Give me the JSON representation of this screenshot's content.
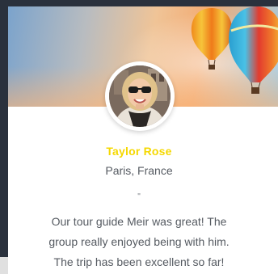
{
  "profile": {
    "name": "Taylor Rose",
    "location": "Paris, France"
  },
  "testimonial": {
    "quote_mark": "\"",
    "text": "Our tour guide Meir was great! The group really enjoyed being with him. The trip has been excellent so far!"
  },
  "colors": {
    "name_accent": "#f5d800",
    "body_text": "#555a61",
    "page_background": "#2a313d",
    "card_background": "#ffffff"
  },
  "images": {
    "banner": "hot-air-balloons-sky",
    "avatar": "woman-with-sunglasses-photo"
  }
}
